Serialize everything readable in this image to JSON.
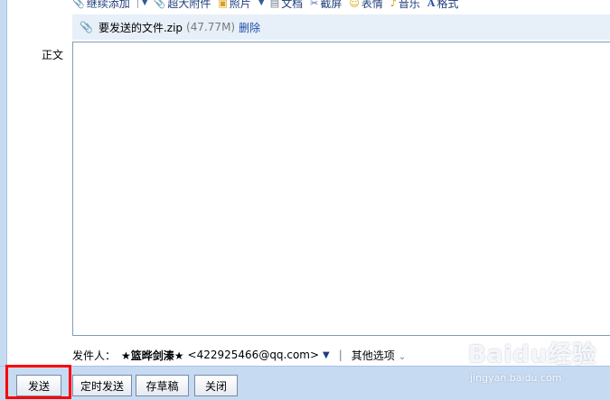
{
  "toolbar": {
    "items": [
      {
        "label": "继续添加",
        "icon": "paperclip-icon"
      },
      {
        "label": "超大附件",
        "icon": "paperclip-icon"
      },
      {
        "label": "照片",
        "icon": "photo-icon"
      },
      {
        "label": "文档",
        "icon": "document-icon"
      },
      {
        "label": "截屏",
        "icon": "screenshot-icon"
      },
      {
        "label": "表情",
        "icon": "smiley-icon"
      },
      {
        "label": "音乐",
        "icon": "music-icon"
      },
      {
        "label": "格式",
        "icon": "format-icon"
      }
    ]
  },
  "attachment": {
    "filename": "要发送的文件.zip",
    "size": "(47.77M)",
    "delete_label": "删除"
  },
  "body_label": "正文",
  "sender": {
    "label": "发件人：",
    "name": "★篮晔剑溱★",
    "email": "<422925466@qq.com>",
    "separator": "|",
    "other_options": "其他选项"
  },
  "buttons": {
    "send": "发送",
    "timed_send": "定时发送",
    "save_draft": "存草稿",
    "close": "关闭"
  },
  "watermark": {
    "logo": "Baidu经验",
    "url": "jingyan.baidu.com"
  },
  "colors": {
    "frame": "#c6daf2",
    "attachment_bar": "#e7eff9",
    "link": "#1f4ea3",
    "highlight": "#ff0000"
  }
}
